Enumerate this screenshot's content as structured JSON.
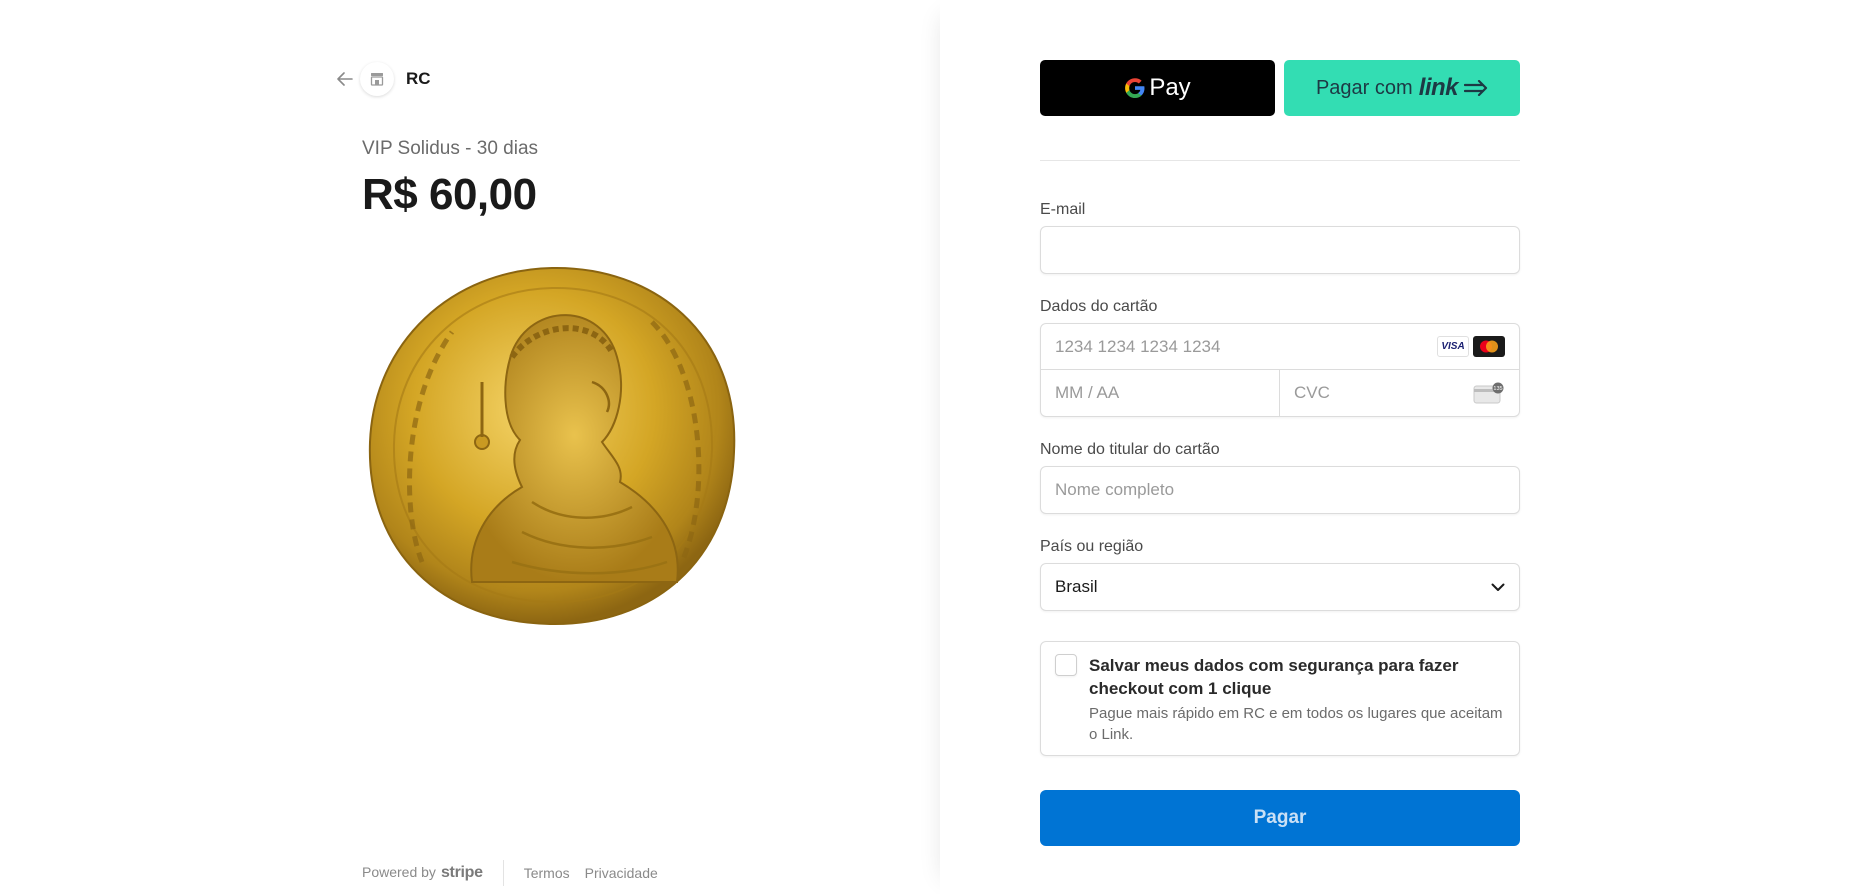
{
  "merchant": {
    "name": "RC"
  },
  "product": {
    "name": "VIP Solidus - 30 dias",
    "price": "R$ 60,00"
  },
  "footer": {
    "powered_by": "Powered by",
    "stripe": "stripe",
    "terms": "Termos",
    "privacy": "Privacidade"
  },
  "wallets": {
    "gpay_label": "Pay",
    "link_prefix": "Pagar com",
    "link_word": "link"
  },
  "form": {
    "email_label": "E-mail",
    "email_value": "",
    "card_label": "Dados do cartão",
    "card_number_placeholder": "1234 1234 1234 1234",
    "expiry_placeholder": "MM / AA",
    "cvc_placeholder": "CVC",
    "cardholder_label": "Nome do titular do cartão",
    "cardholder_placeholder": "Nome completo",
    "country_label": "País ou região",
    "country_value": "Brasil",
    "save_title": "Salvar meus dados com segurança para fazer checkout com 1 clique",
    "save_subtitle": "Pague mais rápido em RC e em todos os lugares que aceitam o Link.",
    "pay_label": "Pagar"
  },
  "icons": {
    "card_brands": [
      "VISA",
      "mastercard"
    ],
    "cvc_hint_code": "135"
  },
  "colors": {
    "pay_button": "#0074d4",
    "link_button": "#33ddb3",
    "gpay_button": "#000000",
    "coin_gold": "#d4a625"
  }
}
